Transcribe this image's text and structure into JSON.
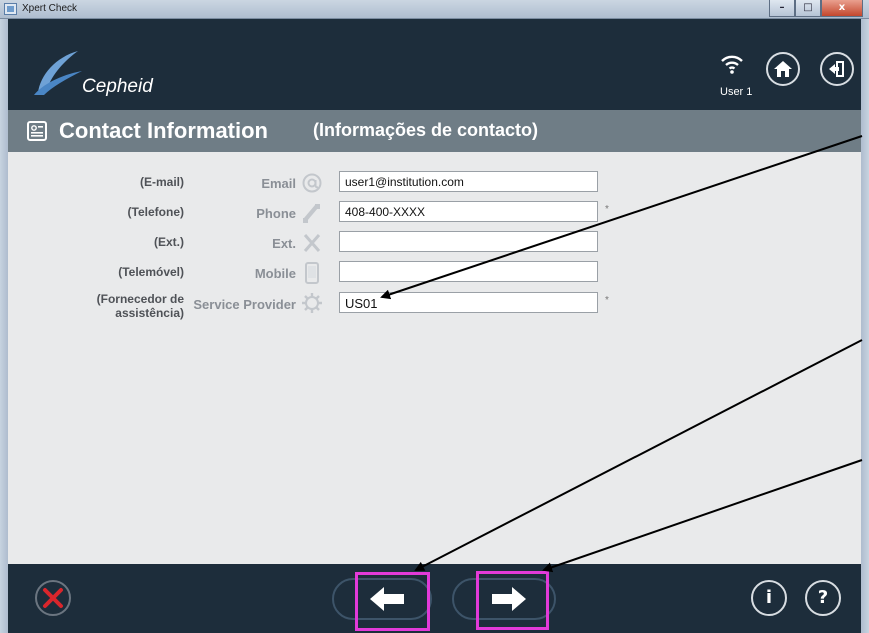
{
  "window": {
    "title": "Xpert Check",
    "controls": {
      "minimize": "–",
      "maximize": "□",
      "close": "x"
    }
  },
  "header": {
    "logo_text": "Cepheid",
    "user_label": "User 1",
    "icons": [
      "wifi-icon",
      "home-icon",
      "exit-icon"
    ]
  },
  "page": {
    "title": "Contact Information",
    "subtitle": "(Informações de contacto)"
  },
  "form": {
    "rows": [
      {
        "translation": "(E-mail)",
        "label": "Email",
        "icon": "at-icon",
        "value": "user1@institution.com",
        "required": ""
      },
      {
        "translation": "(Telefone)",
        "label": "Phone",
        "icon": "phone-icon",
        "value": "408-400-XXXX",
        "required": "*"
      },
      {
        "translation": "(Ext.)",
        "label": "Ext.",
        "icon": "ext-x-icon",
        "value": "",
        "required": ""
      },
      {
        "translation": "(Telemóvel)",
        "label": "Mobile",
        "icon": "mobile-icon",
        "value": "",
        "required": ""
      },
      {
        "translation_line1": "(Fornecedor de",
        "translation_line2": "assistência)",
        "label": "Service Provider",
        "icon": "gear-icon",
        "value": "US01",
        "required": "*"
      }
    ]
  },
  "footer": {
    "info_label": "i",
    "help_label": "?",
    "icons": [
      "cancel-x-icon",
      "back-arrow-icon",
      "next-arrow-icon"
    ]
  },
  "colors": {
    "header_bg": "#1d2d3b",
    "pagebar_bg": "#6f7d86",
    "content_bg": "#e9eaeb",
    "highlight": "#e23ad9",
    "cancel_red": "#d9262c"
  }
}
